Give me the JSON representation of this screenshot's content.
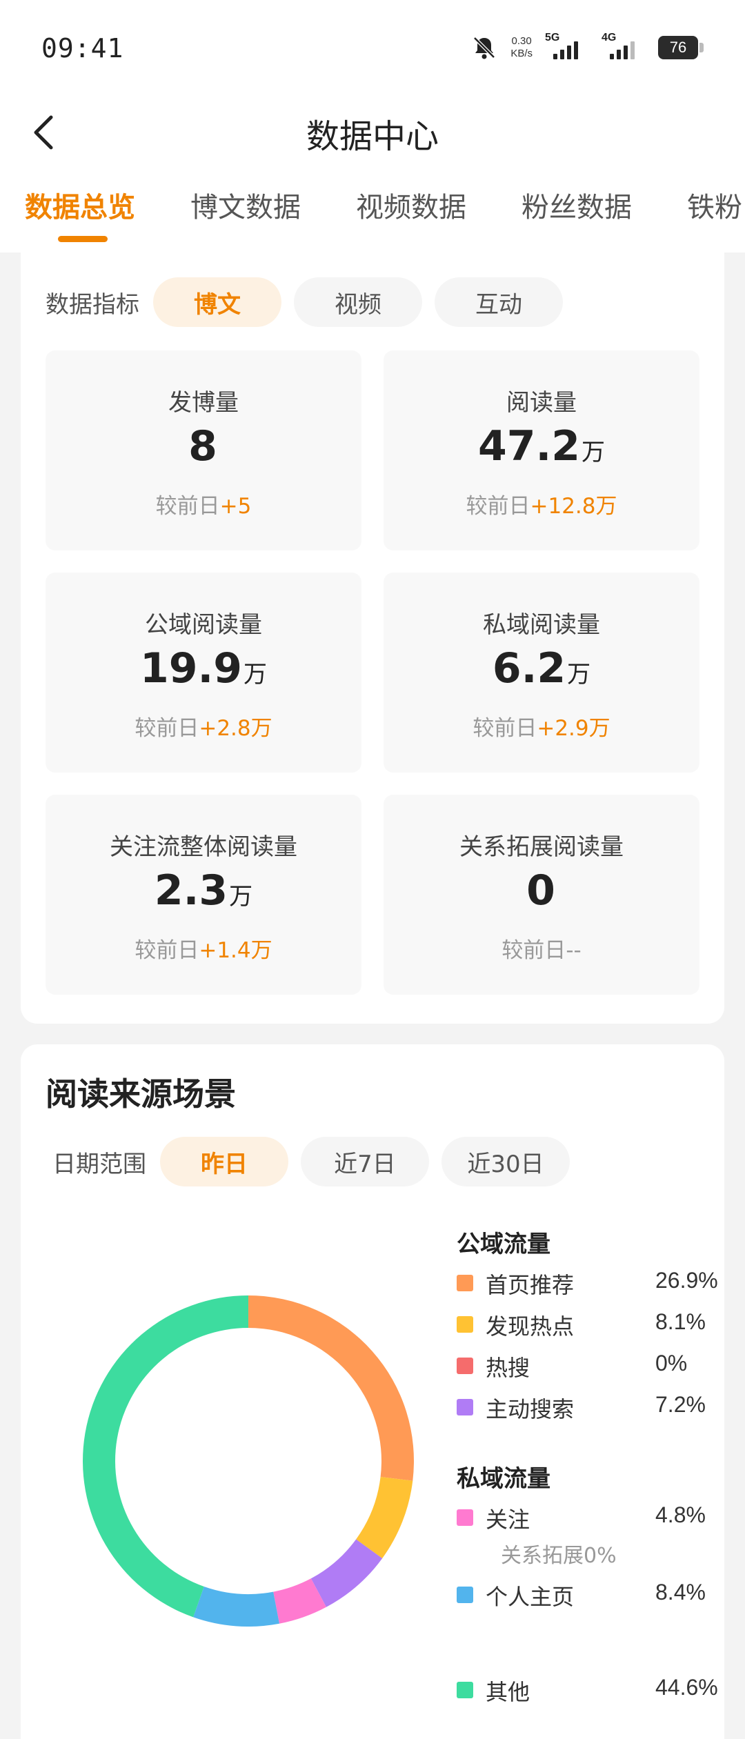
{
  "status_bar": {
    "time": "09:41",
    "net_speed_value": "0.30",
    "net_speed_unit": "KB/s",
    "signal_1_label": "5G",
    "signal_2_label": "4G",
    "battery": "76"
  },
  "header": {
    "title": "数据中心"
  },
  "tabs": [
    {
      "label": "数据总览",
      "active": true
    },
    {
      "label": "博文数据",
      "active": false
    },
    {
      "label": "视频数据",
      "active": false
    },
    {
      "label": "粉丝数据",
      "active": false
    },
    {
      "label": "铁粉",
      "active": false
    }
  ],
  "metrics_section": {
    "filter_label": "数据指标",
    "filters": [
      {
        "label": "博文",
        "active": true
      },
      {
        "label": "视频",
        "active": false
      },
      {
        "label": "互动",
        "active": false
      }
    ],
    "cards": [
      {
        "label": "发博量",
        "value": "8",
        "unit": "",
        "change_prefix": "较前日",
        "change": "+5"
      },
      {
        "label": "阅读量",
        "value": "47.2",
        "unit": "万",
        "change_prefix": "较前日",
        "change": "+12.8万"
      },
      {
        "label": "公域阅读量",
        "value": "19.9",
        "unit": "万",
        "change_prefix": "较前日",
        "change": "+2.8万"
      },
      {
        "label": "私域阅读量",
        "value": "6.2",
        "unit": "万",
        "change_prefix": "较前日",
        "change": "+2.9万"
      },
      {
        "label": "关注流整体阅读量",
        "value": "2.3",
        "unit": "万",
        "change_prefix": "较前日",
        "change": "+1.4万"
      },
      {
        "label": "关系拓展阅读量",
        "value": "0",
        "unit": "",
        "change_prefix": "较前日",
        "change": "--"
      }
    ]
  },
  "source_section": {
    "title": "阅读来源场景",
    "date_label": "日期范围",
    "date_options": [
      {
        "label": "昨日",
        "active": true
      },
      {
        "label": "近7日",
        "active": false
      },
      {
        "label": "近30日",
        "active": false
      }
    ],
    "public_heading": "公域流量",
    "private_heading": "私域流量",
    "relation_note": "关系拓展0%"
  },
  "chart_data": {
    "type": "pie",
    "donut": true,
    "slices": [
      {
        "label": "首页推荐",
        "value": 26.9,
        "display": "26.9%",
        "color": "#ff9a55",
        "group": "公域流量"
      },
      {
        "label": "发现热点",
        "value": 8.1,
        "display": "8.1%",
        "color": "#ffc233",
        "group": "公域流量"
      },
      {
        "label": "热搜",
        "value": 0,
        "display": "0%",
        "color": "#f56c6c",
        "group": "公域流量"
      },
      {
        "label": "主动搜索",
        "value": 7.2,
        "display": "7.2%",
        "color": "#b07cf5",
        "group": "公域流量"
      },
      {
        "label": "关注",
        "value": 4.8,
        "display": "4.8%",
        "color": "#ff7ad0",
        "group": "私域流量"
      },
      {
        "label": "个人主页",
        "value": 8.4,
        "display": "8.4%",
        "color": "#52b4ed",
        "group": "私域流量"
      },
      {
        "label": "其他",
        "value": 44.6,
        "display": "44.6%",
        "color": "#3ddc9f",
        "group": ""
      }
    ]
  }
}
